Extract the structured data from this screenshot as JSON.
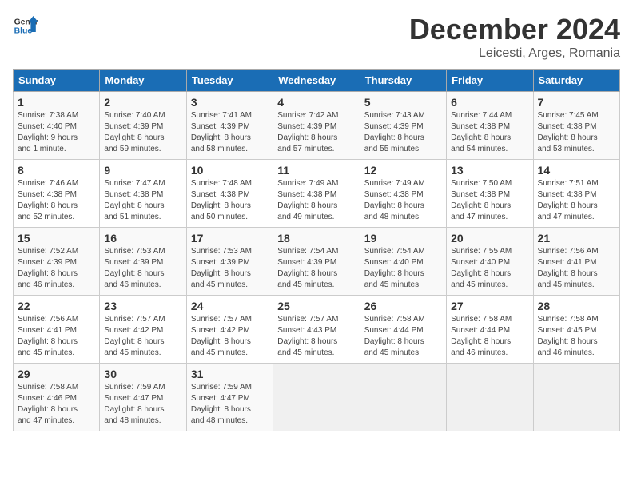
{
  "header": {
    "logo_general": "General",
    "logo_blue": "Blue",
    "month": "December 2024",
    "location": "Leicesti, Arges, Romania"
  },
  "weekdays": [
    "Sunday",
    "Monday",
    "Tuesday",
    "Wednesday",
    "Thursday",
    "Friday",
    "Saturday"
  ],
  "weeks": [
    [
      {
        "day": "1",
        "info": "Sunrise: 7:38 AM\nSunset: 4:40 PM\nDaylight: 9 hours\nand 1 minute."
      },
      {
        "day": "2",
        "info": "Sunrise: 7:40 AM\nSunset: 4:39 PM\nDaylight: 8 hours\nand 59 minutes."
      },
      {
        "day": "3",
        "info": "Sunrise: 7:41 AM\nSunset: 4:39 PM\nDaylight: 8 hours\nand 58 minutes."
      },
      {
        "day": "4",
        "info": "Sunrise: 7:42 AM\nSunset: 4:39 PM\nDaylight: 8 hours\nand 57 minutes."
      },
      {
        "day": "5",
        "info": "Sunrise: 7:43 AM\nSunset: 4:39 PM\nDaylight: 8 hours\nand 55 minutes."
      },
      {
        "day": "6",
        "info": "Sunrise: 7:44 AM\nSunset: 4:38 PM\nDaylight: 8 hours\nand 54 minutes."
      },
      {
        "day": "7",
        "info": "Sunrise: 7:45 AM\nSunset: 4:38 PM\nDaylight: 8 hours\nand 53 minutes."
      }
    ],
    [
      {
        "day": "8",
        "info": "Sunrise: 7:46 AM\nSunset: 4:38 PM\nDaylight: 8 hours\nand 52 minutes."
      },
      {
        "day": "9",
        "info": "Sunrise: 7:47 AM\nSunset: 4:38 PM\nDaylight: 8 hours\nand 51 minutes."
      },
      {
        "day": "10",
        "info": "Sunrise: 7:48 AM\nSunset: 4:38 PM\nDaylight: 8 hours\nand 50 minutes."
      },
      {
        "day": "11",
        "info": "Sunrise: 7:49 AM\nSunset: 4:38 PM\nDaylight: 8 hours\nand 49 minutes."
      },
      {
        "day": "12",
        "info": "Sunrise: 7:49 AM\nSunset: 4:38 PM\nDaylight: 8 hours\nand 48 minutes."
      },
      {
        "day": "13",
        "info": "Sunrise: 7:50 AM\nSunset: 4:38 PM\nDaylight: 8 hours\nand 47 minutes."
      },
      {
        "day": "14",
        "info": "Sunrise: 7:51 AM\nSunset: 4:38 PM\nDaylight: 8 hours\nand 47 minutes."
      }
    ],
    [
      {
        "day": "15",
        "info": "Sunrise: 7:52 AM\nSunset: 4:39 PM\nDaylight: 8 hours\nand 46 minutes."
      },
      {
        "day": "16",
        "info": "Sunrise: 7:53 AM\nSunset: 4:39 PM\nDaylight: 8 hours\nand 46 minutes."
      },
      {
        "day": "17",
        "info": "Sunrise: 7:53 AM\nSunset: 4:39 PM\nDaylight: 8 hours\nand 45 minutes."
      },
      {
        "day": "18",
        "info": "Sunrise: 7:54 AM\nSunset: 4:39 PM\nDaylight: 8 hours\nand 45 minutes."
      },
      {
        "day": "19",
        "info": "Sunrise: 7:54 AM\nSunset: 4:40 PM\nDaylight: 8 hours\nand 45 minutes."
      },
      {
        "day": "20",
        "info": "Sunrise: 7:55 AM\nSunset: 4:40 PM\nDaylight: 8 hours\nand 45 minutes."
      },
      {
        "day": "21",
        "info": "Sunrise: 7:56 AM\nSunset: 4:41 PM\nDaylight: 8 hours\nand 45 minutes."
      }
    ],
    [
      {
        "day": "22",
        "info": "Sunrise: 7:56 AM\nSunset: 4:41 PM\nDaylight: 8 hours\nand 45 minutes."
      },
      {
        "day": "23",
        "info": "Sunrise: 7:57 AM\nSunset: 4:42 PM\nDaylight: 8 hours\nand 45 minutes."
      },
      {
        "day": "24",
        "info": "Sunrise: 7:57 AM\nSunset: 4:42 PM\nDaylight: 8 hours\nand 45 minutes."
      },
      {
        "day": "25",
        "info": "Sunrise: 7:57 AM\nSunset: 4:43 PM\nDaylight: 8 hours\nand 45 minutes."
      },
      {
        "day": "26",
        "info": "Sunrise: 7:58 AM\nSunset: 4:44 PM\nDaylight: 8 hours\nand 45 minutes."
      },
      {
        "day": "27",
        "info": "Sunrise: 7:58 AM\nSunset: 4:44 PM\nDaylight: 8 hours\nand 46 minutes."
      },
      {
        "day": "28",
        "info": "Sunrise: 7:58 AM\nSunset: 4:45 PM\nDaylight: 8 hours\nand 46 minutes."
      }
    ],
    [
      {
        "day": "29",
        "info": "Sunrise: 7:58 AM\nSunset: 4:46 PM\nDaylight: 8 hours\nand 47 minutes."
      },
      {
        "day": "30",
        "info": "Sunrise: 7:59 AM\nSunset: 4:47 PM\nDaylight: 8 hours\nand 48 minutes."
      },
      {
        "day": "31",
        "info": "Sunrise: 7:59 AM\nSunset: 4:47 PM\nDaylight: 8 hours\nand 48 minutes."
      },
      {
        "day": "",
        "info": ""
      },
      {
        "day": "",
        "info": ""
      },
      {
        "day": "",
        "info": ""
      },
      {
        "day": "",
        "info": ""
      }
    ]
  ]
}
